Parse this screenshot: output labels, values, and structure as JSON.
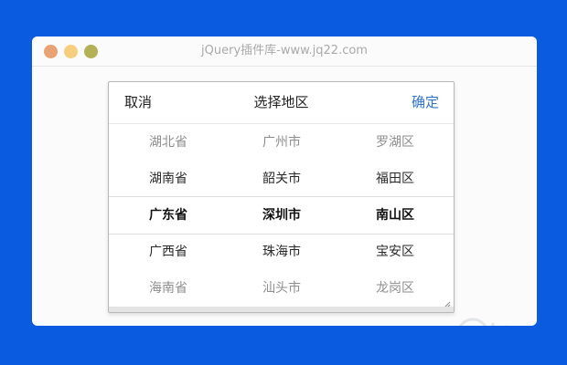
{
  "window": {
    "title": "jQuery插件库-www.jq22.com"
  },
  "picker": {
    "cancel_label": "取消",
    "title": "选择地区",
    "confirm_label": "确定",
    "rows": [
      {
        "province": "湖北省",
        "city": "广州市",
        "district": "罗湖区",
        "state": "far"
      },
      {
        "province": "湖南省",
        "city": "韶关市",
        "district": "福田区",
        "state": "near"
      },
      {
        "province": "广东省",
        "city": "深圳市",
        "district": "南山区",
        "state": "selected"
      },
      {
        "province": "广西省",
        "city": "珠海市",
        "district": "宝安区",
        "state": "near"
      },
      {
        "province": "海南省",
        "city": "汕头市",
        "district": "龙岗区",
        "state": "far"
      }
    ]
  },
  "colors": {
    "background": "#0b5be0",
    "dot_red": "#e9a273",
    "dot_yellow": "#f6cf7e",
    "dot_green": "#b3b055",
    "confirm": "#2f73c6"
  },
  "icons": {
    "resize": "resize-grip-icon",
    "watermark": "jquery-logo-watermark"
  }
}
